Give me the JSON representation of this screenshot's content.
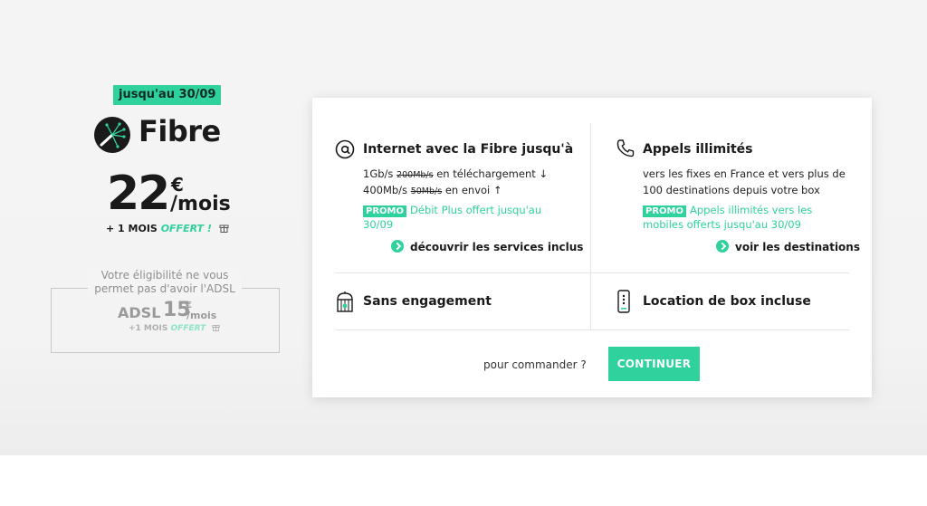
{
  "left_panel": {
    "badge": "jusqu'au 30/09",
    "title": "Fibre",
    "price": "22",
    "currency": "€",
    "period": "/mois",
    "offer_prefix": "+ 1 MOIS",
    "offer_highlight": "OFFERT !",
    "eligibility_text": "Votre éligibilité ne vous permet pas d'avoir l'ADSL",
    "adsl": {
      "name": "ADSL",
      "price": "15",
      "currency": "€",
      "period": "/mois",
      "offer_prefix": "+1 MOIS",
      "offer_highlight": "OFFERT"
    }
  },
  "card": {
    "internet": {
      "title": "Internet avec la Fibre jusqu'à",
      "download_speed": "1Gb/s",
      "download_old": "200Mb/s",
      "download_label": "en téléchargement ↓",
      "upload_speed": "400Mb/s",
      "upload_old": "50Mb/s",
      "upload_label": "en envoi ↑",
      "promo_tag": "PROMO",
      "promo_text": "Débit Plus offert jusqu'au 30/09",
      "link": "découvrir les services inclus"
    },
    "calls": {
      "title": "Appels illimités",
      "line1": "vers les fixes en France et vers plus de",
      "line2": "100 destinations depuis votre box",
      "promo_tag": "PROMO",
      "promo_text": "Appels illimités vers les mobiles offerts jusqu'au 30/09",
      "link": "voir les destinations"
    },
    "commitment": {
      "title": "Sans engagement"
    },
    "box": {
      "title": "Location de box incluse"
    },
    "order_label": "pour commander ?",
    "continue_label": "CONTINUER"
  },
  "colors": {
    "accent": "#2fd19d",
    "text": "#1a1a1a",
    "muted": "#9a9a9a"
  }
}
